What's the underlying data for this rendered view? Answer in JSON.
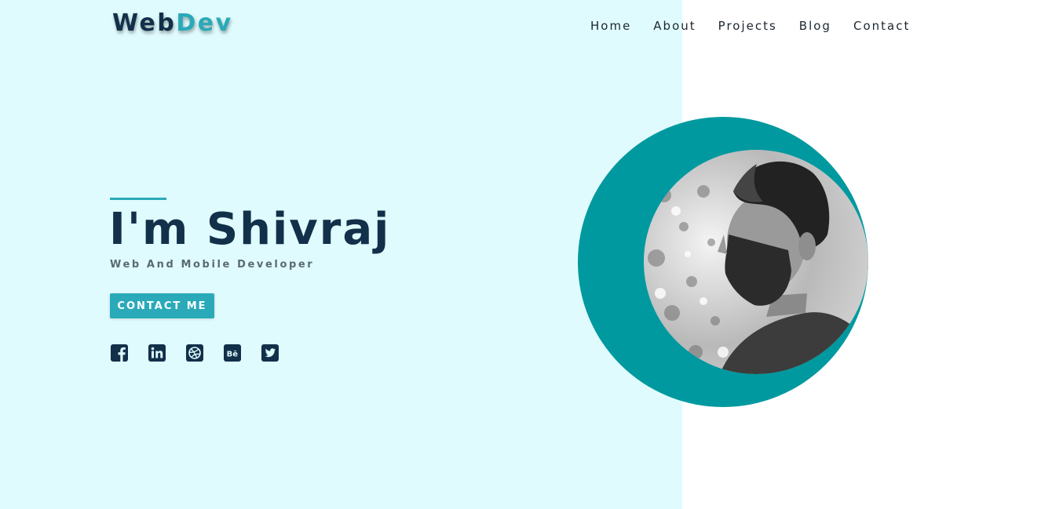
{
  "brand": {
    "logo_part1": "Web",
    "logo_part2": "Dev"
  },
  "nav": {
    "items": [
      "Home",
      "About",
      "Projects",
      "Blog",
      "Contact"
    ]
  },
  "hero": {
    "title": "I'm Shivraj",
    "subtitle": "Web And Mobile Developer",
    "cta_label": "CONTACT ME"
  },
  "socials": [
    "facebook-icon",
    "linkedin-icon",
    "dribbble-icon",
    "behance-icon",
    "twitter-icon"
  ],
  "colors": {
    "left_background": "#e0fbfd",
    "accent": "#2aaab9",
    "ring": "#00999f",
    "dark": "#12304a"
  }
}
